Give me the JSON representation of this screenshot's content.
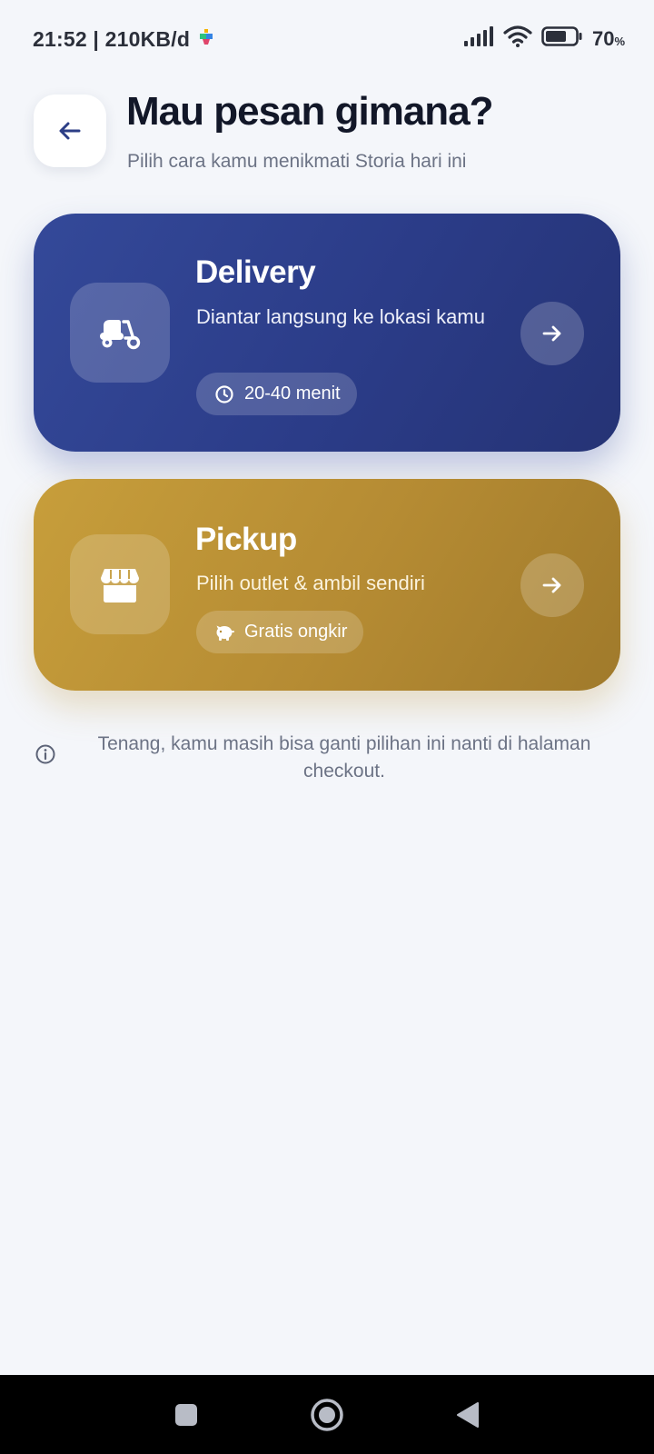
{
  "status_bar": {
    "time_speed": "21:52 | 210KB/d",
    "battery_percent": "70",
    "battery_unit": "%",
    "battery_level": 0.7
  },
  "header": {
    "back_icon": "arrow-left-icon",
    "title": "Mau pesan gimana?",
    "subtitle": "Pilih cara kamu menikmati Storia hari ini"
  },
  "options": {
    "delivery": {
      "icon": "scooter-icon",
      "title": "Delivery",
      "description": "Diantar langsung ke lokasi kamu",
      "chip_icon": "clock-icon",
      "chip_label": "20-40 menit",
      "arrow_icon": "arrow-right-icon",
      "color": "#344999"
    },
    "pickup": {
      "icon": "store-icon",
      "title": "Pickup",
      "description": "Pilih outlet & ambil sendiri",
      "chip_icon": "piggy-bank-icon",
      "chip_label": "Gratis ongkir",
      "arrow_icon": "arrow-right-icon",
      "color": "#c79e3b"
    }
  },
  "info": {
    "icon": "info-icon",
    "text": "Tenang, kamu masih bisa ganti pilihan ini nanti di halaman checkout."
  },
  "nav_bar": {
    "recent_icon": "square-icon",
    "home_icon": "circle-home-icon",
    "back_icon": "triangle-back-icon"
  }
}
